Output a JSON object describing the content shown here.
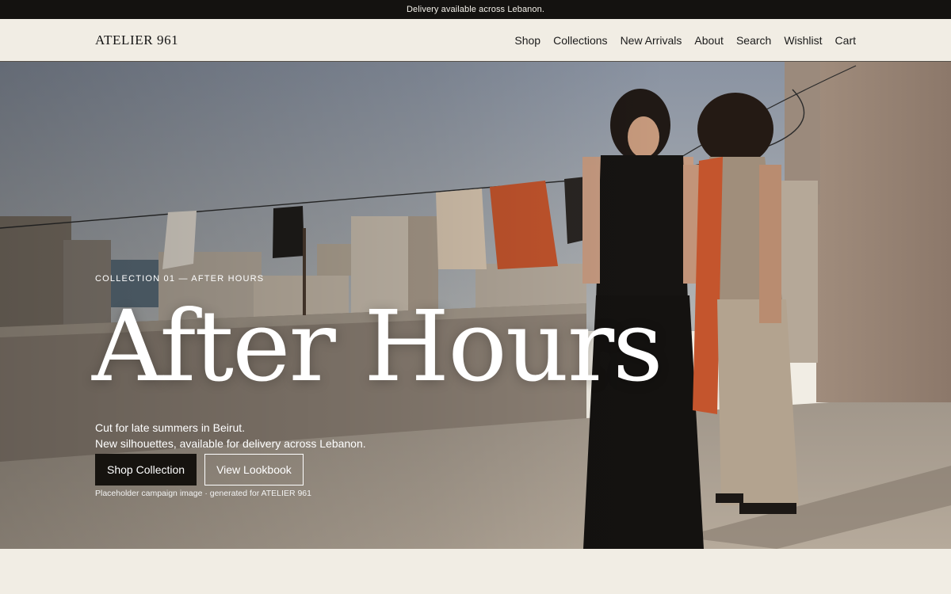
{
  "announcement": {
    "text": "Delivery available across Lebanon."
  },
  "header": {
    "logo": "ATELIER 961",
    "nav": [
      "Shop",
      "Collections",
      "New Arrivals",
      "About",
      "Search",
      "Wishlist",
      "Cart"
    ]
  },
  "hero": {
    "eyebrow": "COLLECTION 01 — AFTER HOURS",
    "title": "After Hours",
    "copy_line1": "Cut for late summers in Beirut.",
    "copy_line2": "New silhouettes, available for delivery across Lebanon.",
    "primary_cta": "Shop Collection",
    "secondary_cta": "View Lookbook",
    "caption": "Placeholder campaign image · generated for ATELIER 961",
    "image_description_icon": "campaign-photo"
  },
  "colors": {
    "announcement_bg": "#141210",
    "header_bg": "#f1ede4",
    "primary_button": "#16130f",
    "accent_terracotta": "#c4552d"
  }
}
